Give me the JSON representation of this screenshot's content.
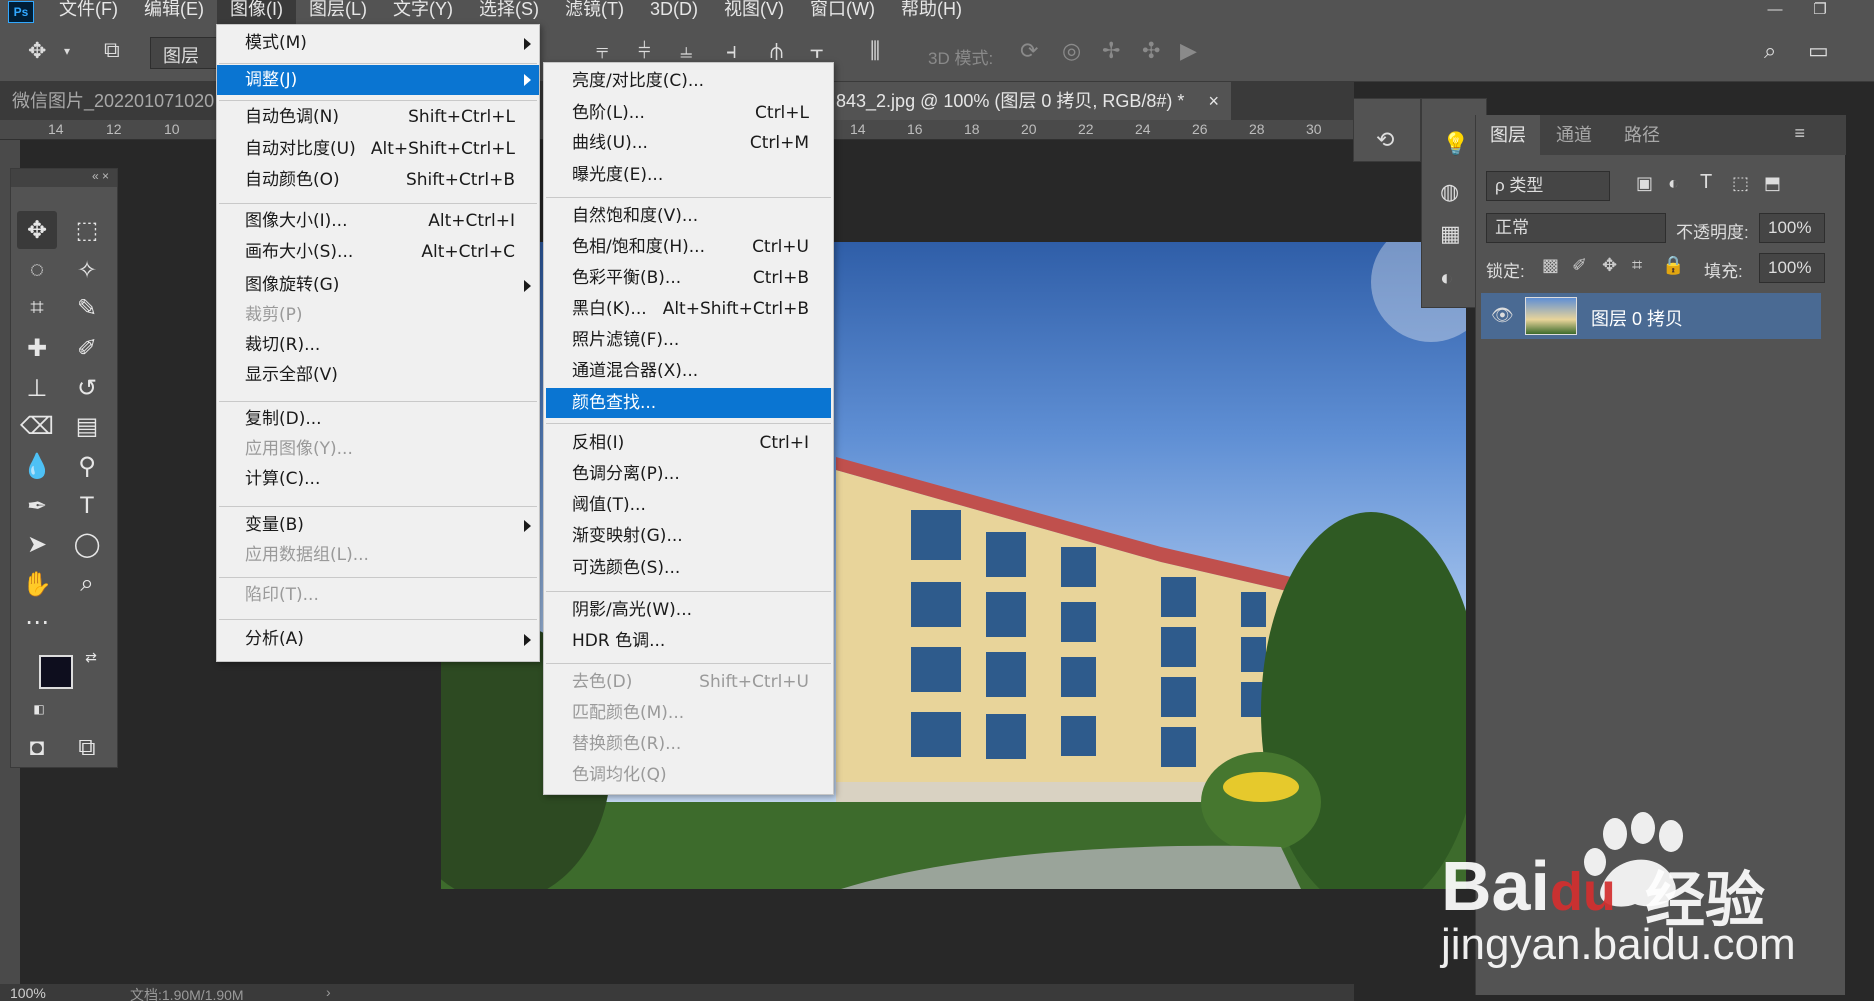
{
  "menubar": {
    "logo": "Ps",
    "items": [
      "文件(F)",
      "编辑(E)",
      "图像(I)",
      "图层(L)",
      "文字(Y)",
      "选择(S)",
      "滤镜(T)",
      "3D(D)",
      "视图(V)",
      "窗口(W)",
      "帮助(H)"
    ]
  },
  "options": {
    "layer_select": "图层",
    "threeD_mode": "3D 模式:"
  },
  "tabs": {
    "inactive": "微信图片_202201071020",
    "active": "843_2.jpg @ 100% (图层 0 拷贝, RGB/8#) *",
    "close": "×"
  },
  "ruler_h": [
    "14",
    "12",
    "10",
    "14",
    "16",
    "18",
    "20",
    "22",
    "24",
    "26",
    "28",
    "30"
  ],
  "image_menu": {
    "items": [
      {
        "label": "模式(M)",
        "shortcut": "",
        "submenu": true,
        "disabled": false
      },
      {
        "label": "调整(J)",
        "shortcut": "",
        "submenu": true,
        "disabled": false,
        "highlight": true
      },
      {
        "label": "自动色调(N)",
        "shortcut": "Shift+Ctrl+L",
        "disabled": false
      },
      {
        "label": "自动对比度(U)",
        "shortcut": "Alt+Shift+Ctrl+L",
        "disabled": false
      },
      {
        "label": "自动颜色(O)",
        "shortcut": "Shift+Ctrl+B",
        "disabled": false
      },
      {
        "label": "图像大小(I)...",
        "shortcut": "Alt+Ctrl+I",
        "disabled": false
      },
      {
        "label": "画布大小(S)...",
        "shortcut": "Alt+Ctrl+C",
        "disabled": false
      },
      {
        "label": "图像旋转(G)",
        "shortcut": "",
        "submenu": true,
        "disabled": false
      },
      {
        "label": "裁剪(P)",
        "shortcut": "",
        "disabled": true
      },
      {
        "label": "裁切(R)...",
        "shortcut": "",
        "disabled": false
      },
      {
        "label": "显示全部(V)",
        "shortcut": "",
        "disabled": false
      },
      {
        "label": "复制(D)...",
        "shortcut": "",
        "disabled": false
      },
      {
        "label": "应用图像(Y)...",
        "shortcut": "",
        "disabled": true
      },
      {
        "label": "计算(C)...",
        "shortcut": "",
        "disabled": false
      },
      {
        "label": "变量(B)",
        "shortcut": "",
        "submenu": true,
        "disabled": false
      },
      {
        "label": "应用数据组(L)...",
        "shortcut": "",
        "disabled": true
      },
      {
        "label": "陷印(T)...",
        "shortcut": "",
        "disabled": true
      },
      {
        "label": "分析(A)",
        "shortcut": "",
        "submenu": true,
        "disabled": false
      }
    ]
  },
  "adjust_menu": {
    "items": [
      {
        "label": "亮度/对比度(C)...",
        "shortcut": ""
      },
      {
        "label": "色阶(L)...",
        "shortcut": "Ctrl+L"
      },
      {
        "label": "曲线(U)...",
        "shortcut": "Ctrl+M"
      },
      {
        "label": "曝光度(E)...",
        "shortcut": ""
      },
      {
        "label": "自然饱和度(V)...",
        "shortcut": ""
      },
      {
        "label": "色相/饱和度(H)...",
        "shortcut": "Ctrl+U"
      },
      {
        "label": "色彩平衡(B)...",
        "shortcut": "Ctrl+B"
      },
      {
        "label": "黑白(K)...",
        "shortcut": "Alt+Shift+Ctrl+B"
      },
      {
        "label": "照片滤镜(F)...",
        "shortcut": ""
      },
      {
        "label": "通道混合器(X)...",
        "shortcut": ""
      },
      {
        "label": "颜色查找...",
        "shortcut": "",
        "highlight": true
      },
      {
        "label": "反相(I)",
        "shortcut": "Ctrl+I"
      },
      {
        "label": "色调分离(P)...",
        "shortcut": ""
      },
      {
        "label": "阈值(T)...",
        "shortcut": ""
      },
      {
        "label": "渐变映射(G)...",
        "shortcut": ""
      },
      {
        "label": "可选颜色(S)...",
        "shortcut": ""
      },
      {
        "label": "阴影/高光(W)...",
        "shortcut": ""
      },
      {
        "label": "HDR 色调...",
        "shortcut": ""
      },
      {
        "label": "去色(D)",
        "shortcut": "Shift+Ctrl+U",
        "disabled": true
      },
      {
        "label": "匹配颜色(M)...",
        "shortcut": "",
        "disabled": true
      },
      {
        "label": "替换颜色(R)...",
        "shortcut": "",
        "disabled": true
      },
      {
        "label": "色调均化(Q)",
        "shortcut": "",
        "disabled": true
      }
    ]
  },
  "layers_panel": {
    "tabs": [
      "图层",
      "通道",
      "路径"
    ],
    "filter": "ρ 类型",
    "blend_mode": "正常",
    "opacity_label": "不透明度:",
    "opacity_value": "100%",
    "lock_label": "锁定:",
    "fill_label": "填充:",
    "fill_value": "100%",
    "layer_name": "图层 0 拷贝"
  },
  "status": {
    "zoom": "100%",
    "doc": "文档:1.90M/1.90M"
  },
  "watermark": {
    "brand": "Bai",
    "brand2": "du",
    "cn": "经验",
    "url": "jingyan.baidu.com"
  },
  "colors": {
    "highlight": "#0a75d2",
    "foreground": "#0e0e1e",
    "background": "#b1232e"
  }
}
